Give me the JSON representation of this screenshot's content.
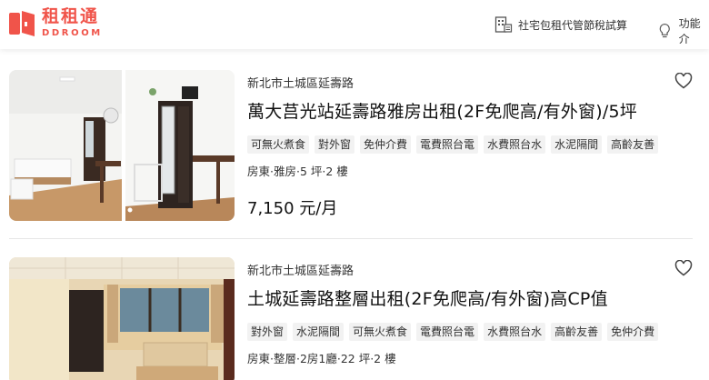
{
  "header": {
    "logo_cn": "租租通",
    "logo_en": "DDROOM",
    "nav": [
      {
        "label": "社宅包租代管節稅試算",
        "icon": "building-calculator-icon"
      },
      {
        "label": "功能介",
        "icon": "lightbulb-icon"
      }
    ]
  },
  "listings": [
    {
      "address": "新北市土城區延壽路",
      "title": "萬大莒光站延壽路雅房出租(2F免爬高/有外窗)/5坪",
      "tags": [
        "可無火煮食",
        "對外窗",
        "免仲介費",
        "電費照台電",
        "水費照台水",
        "水泥隔間",
        "高齡友善"
      ],
      "meta": "房東·雅房·5 坪·2 樓",
      "price": "7,150 元/月"
    },
    {
      "address": "新北市土城區延壽路",
      "title": "土城延壽路整層出租(2F免爬高/有外窗)高CP值",
      "tags": [
        "對外窗",
        "水泥隔間",
        "可無火煮食",
        "電費照台電",
        "水費照台水",
        "高齡友善",
        "免仲介費"
      ],
      "meta": "房東·整層·2房1廳·22 坪·2 樓"
    }
  ],
  "colors": {
    "brand": "#f0544a",
    "tag_bg": "#f2f2f2"
  }
}
